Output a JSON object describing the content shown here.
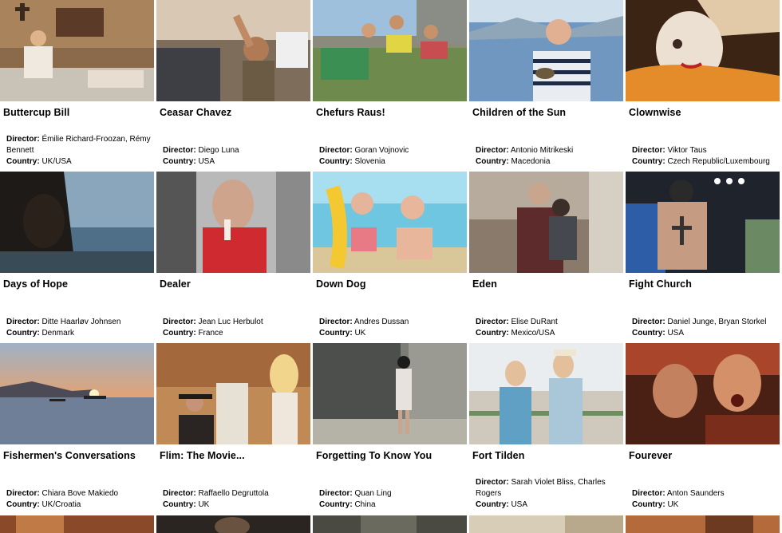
{
  "labels": {
    "director": "Director:",
    "country": "Country:"
  },
  "films": [
    {
      "title": "Buttercup Bill",
      "director": "Émilie Richard-Froozan, Rémy Bennett",
      "country": "UK/USA"
    },
    {
      "title": "Ceasar Chavez",
      "director": "Diego Luna",
      "country": "USA"
    },
    {
      "title": "Chefurs Raus!",
      "director": "Goran Vojnovic",
      "country": "Slovenia"
    },
    {
      "title": "Children of the Sun",
      "director": "Antonio Mitrikeski",
      "country": "Macedonia"
    },
    {
      "title": "Clownwise",
      "director": "Viktor Taus",
      "country": "Czech Republic/Luxembourg"
    },
    {
      "title": "Days of Hope",
      "director": "Ditte Haarløv Johnsen",
      "country": "Denmark"
    },
    {
      "title": "Dealer",
      "director": "Jean Luc Herbulot",
      "country": "France"
    },
    {
      "title": "Down Dog",
      "director": "Andres Dussan",
      "country": "UK"
    },
    {
      "title": "Eden",
      "director": "Elise DuRant",
      "country": "Mexico/USA"
    },
    {
      "title": "Fight Church",
      "director": "Daniel Junge, Bryan Storkel",
      "country": "USA"
    },
    {
      "title": "Fishermen's Conversations",
      "director": "Chiara Bove Makiedo",
      "country": "UK/Croatia"
    },
    {
      "title": "Flim: The Movie...",
      "director": "Raffaello Degruttola",
      "country": "UK"
    },
    {
      "title": "Forgetting To Know You",
      "director": "Quan Ling",
      "country": "China"
    },
    {
      "title": "Fort Tilden",
      "director": "Sarah Violet Bliss, Charles Rogers",
      "country": "USA"
    },
    {
      "title": "Fourever",
      "director": "Anton Saunders",
      "country": "UK"
    }
  ]
}
